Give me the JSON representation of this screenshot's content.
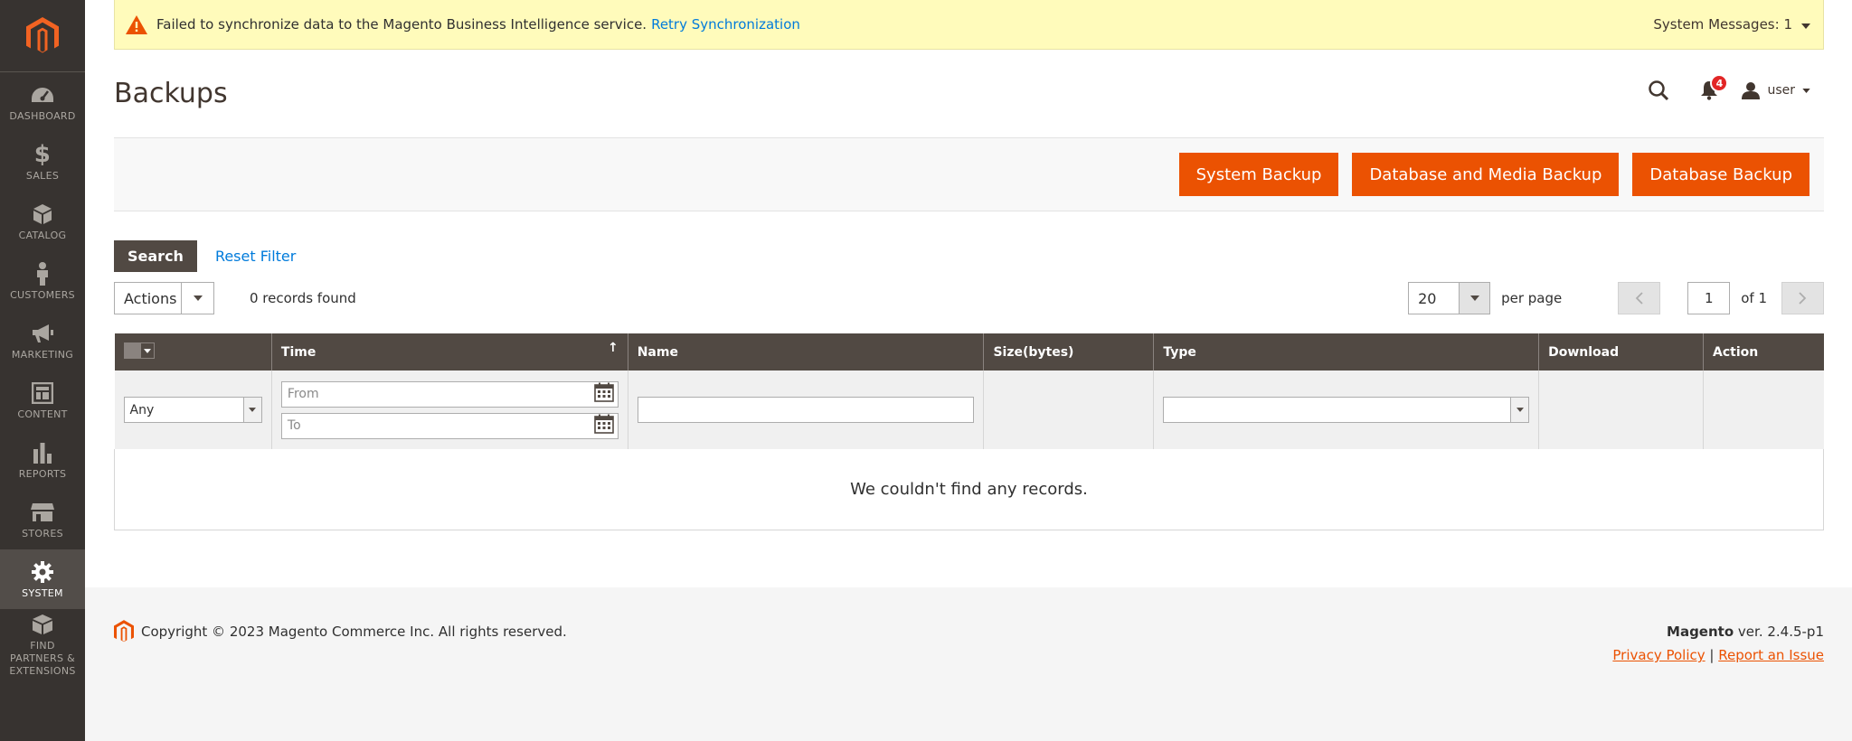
{
  "sidebar": {
    "items": [
      {
        "label": "Dashboard",
        "icon": "dashboard-icon"
      },
      {
        "label": "Sales",
        "icon": "dollar-icon"
      },
      {
        "label": "Catalog",
        "icon": "box-icon"
      },
      {
        "label": "Customers",
        "icon": "person-icon"
      },
      {
        "label": "Marketing",
        "icon": "megaphone-icon"
      },
      {
        "label": "Content",
        "icon": "layout-icon"
      },
      {
        "label": "Reports",
        "icon": "bar-chart-icon"
      },
      {
        "label": "Stores",
        "icon": "store-icon"
      },
      {
        "label": "System",
        "icon": "gear-icon"
      },
      {
        "label": "Find Partners & Extensions",
        "icon": "cubes-icon"
      }
    ]
  },
  "system_message": {
    "text": "Failed to synchronize data to the Magento Business Intelligence service.",
    "link": "Retry Synchronization",
    "counter": "System Messages: 1"
  },
  "header": {
    "title": "Backups",
    "notifications_count": "4",
    "user": "user"
  },
  "actions_bar": {
    "system_backup": "System Backup",
    "db_media_backup": "Database and Media Backup",
    "db_backup": "Database Backup"
  },
  "search": {
    "search_label": "Search",
    "reset_label": "Reset Filter"
  },
  "toolbar": {
    "actions": "Actions",
    "records": "0 records found",
    "per_page_value": "20",
    "per_page_label": "per page",
    "current_page": "1",
    "of_pages": "of 1"
  },
  "grid": {
    "columns": [
      "Time",
      "Name",
      "Size(bytes)",
      "Type",
      "Download",
      "Action"
    ],
    "filter_any": "Any",
    "from_placeholder": "From",
    "to_placeholder": "To",
    "empty": "We couldn't find any records."
  },
  "footer": {
    "copyright": "Copyright © 2023 Magento Commerce Inc. All rights reserved.",
    "brand": "Magento",
    "version": "ver. 2.4.5-p1",
    "privacy": "Privacy Policy",
    "separator": "|",
    "report": "Report an Issue"
  },
  "colors": {
    "accent": "#eb5202",
    "sidebar": "#373330",
    "grid_header": "#514943",
    "link": "#007bdb"
  }
}
